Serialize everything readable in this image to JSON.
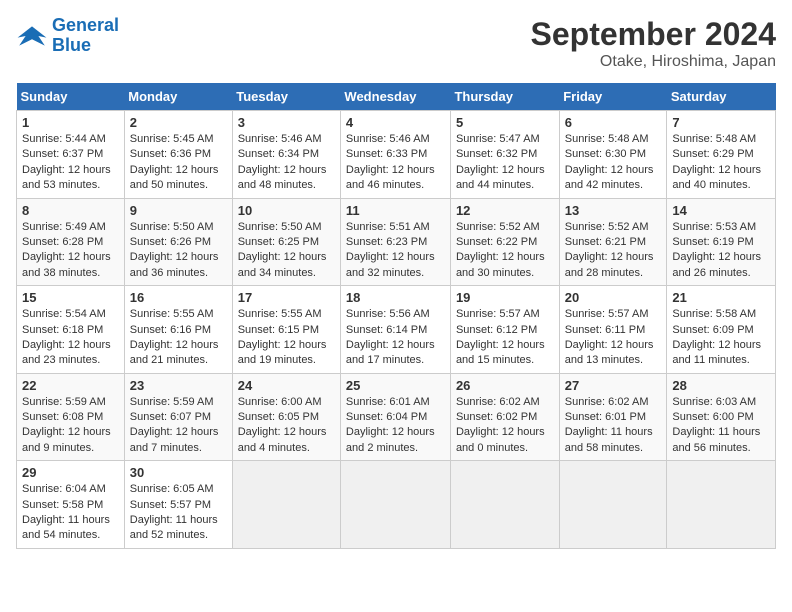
{
  "header": {
    "logo_line1": "General",
    "logo_line2": "Blue",
    "month": "September 2024",
    "location": "Otake, Hiroshima, Japan"
  },
  "weekdays": [
    "Sunday",
    "Monday",
    "Tuesday",
    "Wednesday",
    "Thursday",
    "Friday",
    "Saturday"
  ],
  "weeks": [
    [
      {
        "day": "1",
        "info": "Sunrise: 5:44 AM\nSunset: 6:37 PM\nDaylight: 12 hours\nand 53 minutes."
      },
      {
        "day": "2",
        "info": "Sunrise: 5:45 AM\nSunset: 6:36 PM\nDaylight: 12 hours\nand 50 minutes."
      },
      {
        "day": "3",
        "info": "Sunrise: 5:46 AM\nSunset: 6:34 PM\nDaylight: 12 hours\nand 48 minutes."
      },
      {
        "day": "4",
        "info": "Sunrise: 5:46 AM\nSunset: 6:33 PM\nDaylight: 12 hours\nand 46 minutes."
      },
      {
        "day": "5",
        "info": "Sunrise: 5:47 AM\nSunset: 6:32 PM\nDaylight: 12 hours\nand 44 minutes."
      },
      {
        "day": "6",
        "info": "Sunrise: 5:48 AM\nSunset: 6:30 PM\nDaylight: 12 hours\nand 42 minutes."
      },
      {
        "day": "7",
        "info": "Sunrise: 5:48 AM\nSunset: 6:29 PM\nDaylight: 12 hours\nand 40 minutes."
      }
    ],
    [
      {
        "day": "8",
        "info": "Sunrise: 5:49 AM\nSunset: 6:28 PM\nDaylight: 12 hours\nand 38 minutes."
      },
      {
        "day": "9",
        "info": "Sunrise: 5:50 AM\nSunset: 6:26 PM\nDaylight: 12 hours\nand 36 minutes."
      },
      {
        "day": "10",
        "info": "Sunrise: 5:50 AM\nSunset: 6:25 PM\nDaylight: 12 hours\nand 34 minutes."
      },
      {
        "day": "11",
        "info": "Sunrise: 5:51 AM\nSunset: 6:23 PM\nDaylight: 12 hours\nand 32 minutes."
      },
      {
        "day": "12",
        "info": "Sunrise: 5:52 AM\nSunset: 6:22 PM\nDaylight: 12 hours\nand 30 minutes."
      },
      {
        "day": "13",
        "info": "Sunrise: 5:52 AM\nSunset: 6:21 PM\nDaylight: 12 hours\nand 28 minutes."
      },
      {
        "day": "14",
        "info": "Sunrise: 5:53 AM\nSunset: 6:19 PM\nDaylight: 12 hours\nand 26 minutes."
      }
    ],
    [
      {
        "day": "15",
        "info": "Sunrise: 5:54 AM\nSunset: 6:18 PM\nDaylight: 12 hours\nand 23 minutes."
      },
      {
        "day": "16",
        "info": "Sunrise: 5:55 AM\nSunset: 6:16 PM\nDaylight: 12 hours\nand 21 minutes."
      },
      {
        "day": "17",
        "info": "Sunrise: 5:55 AM\nSunset: 6:15 PM\nDaylight: 12 hours\nand 19 minutes."
      },
      {
        "day": "18",
        "info": "Sunrise: 5:56 AM\nSunset: 6:14 PM\nDaylight: 12 hours\nand 17 minutes."
      },
      {
        "day": "19",
        "info": "Sunrise: 5:57 AM\nSunset: 6:12 PM\nDaylight: 12 hours\nand 15 minutes."
      },
      {
        "day": "20",
        "info": "Sunrise: 5:57 AM\nSunset: 6:11 PM\nDaylight: 12 hours\nand 13 minutes."
      },
      {
        "day": "21",
        "info": "Sunrise: 5:58 AM\nSunset: 6:09 PM\nDaylight: 12 hours\nand 11 minutes."
      }
    ],
    [
      {
        "day": "22",
        "info": "Sunrise: 5:59 AM\nSunset: 6:08 PM\nDaylight: 12 hours\nand 9 minutes."
      },
      {
        "day": "23",
        "info": "Sunrise: 5:59 AM\nSunset: 6:07 PM\nDaylight: 12 hours\nand 7 minutes."
      },
      {
        "day": "24",
        "info": "Sunrise: 6:00 AM\nSunset: 6:05 PM\nDaylight: 12 hours\nand 4 minutes."
      },
      {
        "day": "25",
        "info": "Sunrise: 6:01 AM\nSunset: 6:04 PM\nDaylight: 12 hours\nand 2 minutes."
      },
      {
        "day": "26",
        "info": "Sunrise: 6:02 AM\nSunset: 6:02 PM\nDaylight: 12 hours\nand 0 minutes."
      },
      {
        "day": "27",
        "info": "Sunrise: 6:02 AM\nSunset: 6:01 PM\nDaylight: 11 hours\nand 58 minutes."
      },
      {
        "day": "28",
        "info": "Sunrise: 6:03 AM\nSunset: 6:00 PM\nDaylight: 11 hours\nand 56 minutes."
      }
    ],
    [
      {
        "day": "29",
        "info": "Sunrise: 6:04 AM\nSunset: 5:58 PM\nDaylight: 11 hours\nand 54 minutes."
      },
      {
        "day": "30",
        "info": "Sunrise: 6:05 AM\nSunset: 5:57 PM\nDaylight: 11 hours\nand 52 minutes."
      },
      null,
      null,
      null,
      null,
      null
    ]
  ]
}
